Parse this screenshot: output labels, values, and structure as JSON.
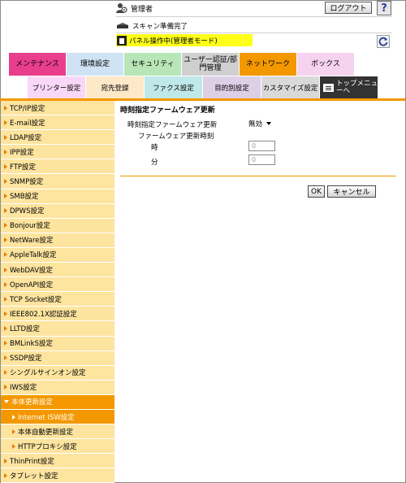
{
  "header": {
    "user_icon": "admin-user-icon",
    "user_label": "管理者",
    "logout_label": "ログアウト",
    "help_label": "?",
    "status_text": "スキャン準備完了",
    "panel_text": "パネル操作中(管理者モード)",
    "colors": {
      "panel_bg": "#ffff1a"
    }
  },
  "tabs": [
    {
      "label": "メンテナンス",
      "color": "#e83e8c"
    },
    {
      "label": "環境設定",
      "color": "#cfe3f5"
    },
    {
      "label": "セキュリティ",
      "color": "#b8e6b8"
    },
    {
      "label": "ユーザー認証/部門管理",
      "color": "#cfcfcf"
    },
    {
      "label": "ネットワーク",
      "color": "#f39800"
    },
    {
      "label": "ボックス",
      "color": "#f5d3f0"
    }
  ],
  "subtabs": [
    {
      "label": "プリンター設定",
      "color": "#f9d7f6"
    },
    {
      "label": "宛先登録",
      "color": "#fde8c8"
    },
    {
      "label": "ファクス設定",
      "color": "#bfe8e8"
    },
    {
      "label": "目的別設定",
      "color": "#ddd0e6"
    },
    {
      "label": "カスタマイズ設定",
      "color": "#d9d9d9"
    },
    {
      "label": "トップメニューへ",
      "color": "#333333"
    }
  ],
  "sidebar": {
    "items": [
      "TCP/IP設定",
      "E-mail設定",
      "LDAP設定",
      "IPP設定",
      "FTP設定",
      "SNMP設定",
      "SMB設定",
      "DPWS設定",
      "Bonjour設定",
      "NetWare設定",
      "AppleTalk設定",
      "WebDAV設定",
      "OpenAPI設定",
      "TCP Socket設定",
      "IEEE802.1X認証設定",
      "LLTD設定",
      "BMLinkS設定",
      "SSDP設定",
      "シングルサインオン設定",
      "IWS設定"
    ],
    "expanded": "本体更新設定",
    "subitems": [
      "Internet ISW設定",
      "本体自動更新設定",
      "HTTPプロキシ設定"
    ],
    "selected_subitem": "Internet ISW設定",
    "after_items": [
      "ThinPrint設定",
      "タブレット設定"
    ]
  },
  "main": {
    "title": "時刻指定ファームウェア更新",
    "field_update_label": "時刻指定ファームウェア更新",
    "field_update_value": "無効",
    "field_time_label": "ファームウェア更新時刻",
    "hour_label": "時",
    "hour_value": "0",
    "minute_label": "分",
    "minute_value": "0",
    "ok_label": "OK",
    "cancel_label": "キャンセル"
  }
}
